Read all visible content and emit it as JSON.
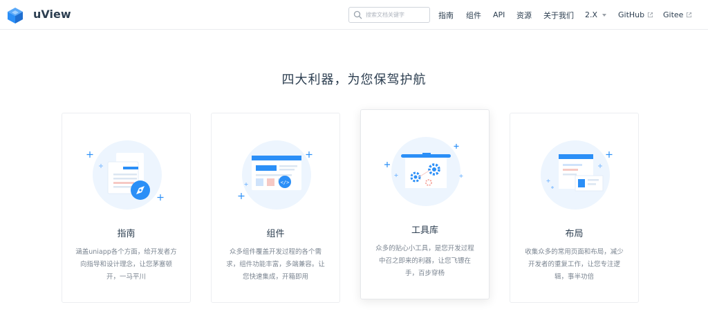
{
  "header": {
    "brand": "uView",
    "search_placeholder": "搜索文档关键字",
    "nav": [
      {
        "label": "指南"
      },
      {
        "label": "组件"
      },
      {
        "label": "API"
      },
      {
        "label": "资源"
      },
      {
        "label": "关于我们"
      },
      {
        "label": "2.X"
      },
      {
        "label": "GitHub"
      },
      {
        "label": "Gitee"
      }
    ]
  },
  "main": {
    "title": "四大利器，为您保驾护航",
    "cards": [
      {
        "title": "指南",
        "desc": "涵盖uniapp各个方面，给开发者方向指导和设计理念，让您茅塞顿开，一马平川"
      },
      {
        "title": "组件",
        "desc": "众多组件覆盖开发过程的各个需求，组件功能丰富，多端兼容。让您快速集成，开箱即用"
      },
      {
        "title": "工具库",
        "desc": "众多的贴心小工具，是您开发过程中召之即来的利器，让您飞镖在手，百步穿杨"
      },
      {
        "title": "布局",
        "desc": "收集众多的常用页面和布局，减少开发者的重复工作，让您专注逻辑，事半功倍"
      }
    ]
  },
  "colors": {
    "accent": "#2b8ff7",
    "illustration_bg": "#edf5fe",
    "text": "#2c3e50",
    "muted": "#7b8591"
  }
}
